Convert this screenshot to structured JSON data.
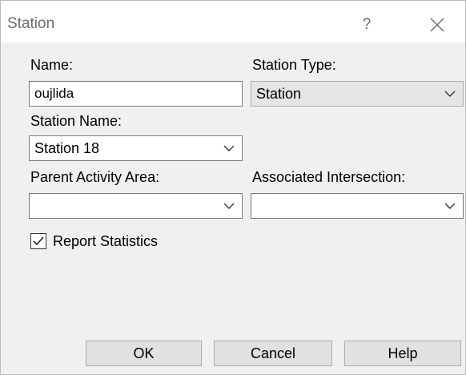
{
  "window": {
    "title": "Station",
    "help_label": "?"
  },
  "form": {
    "name_label": "Name:",
    "name_value": "oujlida",
    "station_type_label": "Station Type:",
    "station_type_value": "Station",
    "station_name_label": "Station Name:",
    "station_name_value": "Station 18",
    "parent_activity_area_label": "Parent Activity Area:",
    "parent_activity_area_value": "",
    "associated_intersection_label": "Associated Intersection:",
    "associated_intersection_value": "",
    "report_statistics_label": "Report Statistics",
    "report_statistics_checked": true
  },
  "buttons": {
    "ok": "OK",
    "cancel": "Cancel",
    "help": "Help"
  },
  "icons": {
    "close": "close-icon",
    "dropdown": "chevron-down-icon",
    "check": "checkmark-icon"
  },
  "colors": {
    "dialog_bg": "#f0f0f0",
    "titlebar_bg": "#ffffff",
    "title_text": "#6d6d6d",
    "button_bg": "#e1e1e1"
  }
}
